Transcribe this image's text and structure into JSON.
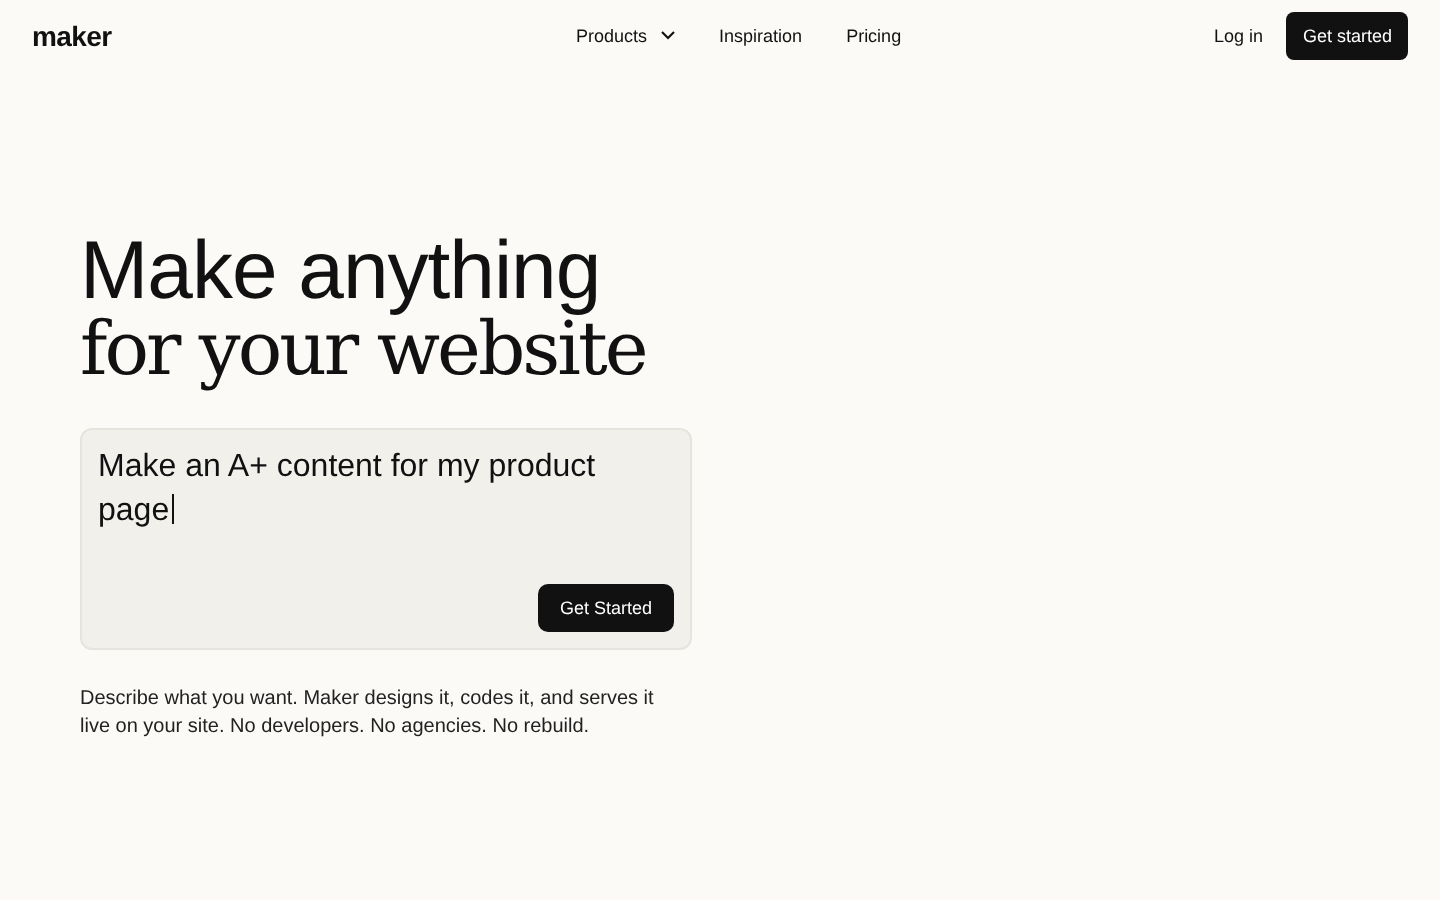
{
  "nav": {
    "logo": "maker",
    "links": [
      {
        "label": "Products",
        "dropdown": true
      },
      {
        "label": "Inspiration",
        "dropdown": false
      },
      {
        "label": "Pricing",
        "dropdown": false
      }
    ],
    "login": "Log in",
    "cta": "Get started"
  },
  "hero": {
    "headline_sans": "Make anything",
    "headline_serif": "for your website",
    "prompt": {
      "value": "Make an A+ content for my product page",
      "focused": true,
      "button": "Get Started"
    },
    "description": "Describe what you want. Maker designs it, codes it, and serves it live on your site. No developers. No agencies. No rebuild."
  }
}
